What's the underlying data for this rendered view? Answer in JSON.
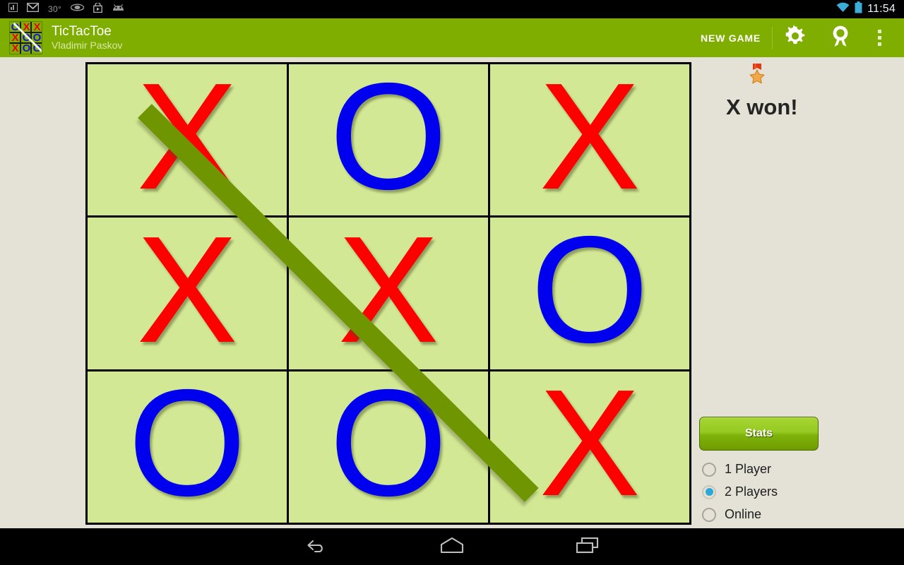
{
  "status_bar": {
    "icons": [
      "chart-icon",
      "gmail-icon",
      "weather-icon",
      "eye-icon",
      "play-store-icon",
      "android-icon"
    ],
    "temperature": "30°",
    "time": "11:54",
    "wifi_icon": "wifi-icon",
    "battery_icon": "battery-icon"
  },
  "action_bar": {
    "app_title": "TicTacToe",
    "app_subtitle": "Vladimir Paskov",
    "logo_icon": "tictactoe-logo-icon",
    "new_game_label": "NEW GAME",
    "settings_icon": "gear-icon",
    "awards_icon": "award-ribbon-icon",
    "overflow_icon": "overflow-menu-icon"
  },
  "board": {
    "cells": [
      {
        "id": "cell-0-0",
        "mark": "X"
      },
      {
        "id": "cell-0-1",
        "mark": "O"
      },
      {
        "id": "cell-0-2",
        "mark": "X"
      },
      {
        "id": "cell-1-0",
        "mark": "X"
      },
      {
        "id": "cell-1-1",
        "mark": "X"
      },
      {
        "id": "cell-1-2",
        "mark": "O"
      },
      {
        "id": "cell-2-0",
        "mark": "O"
      },
      {
        "id": "cell-2-1",
        "mark": "O"
      },
      {
        "id": "cell-2-2",
        "mark": "X"
      }
    ],
    "winning_line": "diagonal-top-left-to-bottom-right",
    "cell_color": "#d3e894",
    "grid_color": "#000000",
    "x_color": "#ff0000",
    "o_color": "#0000ee",
    "win_line_color": "#6f9500"
  },
  "right_panel": {
    "medal_icon": "medal-star-icon",
    "result_text": "X won!",
    "stats_label": "Stats",
    "mode_options": [
      {
        "label": "1 Player",
        "selected": false
      },
      {
        "label": "2 Players",
        "selected": true
      },
      {
        "label": "Online",
        "selected": false
      }
    ]
  },
  "nav_bar": {
    "back_icon": "back-arrow-icon",
    "home_icon": "home-icon",
    "recents_icon": "recent-apps-icon"
  },
  "theme": {
    "accent_green": "#7fae00",
    "background": "#e4e2d7",
    "radio_selected": "#2ca8d8"
  }
}
